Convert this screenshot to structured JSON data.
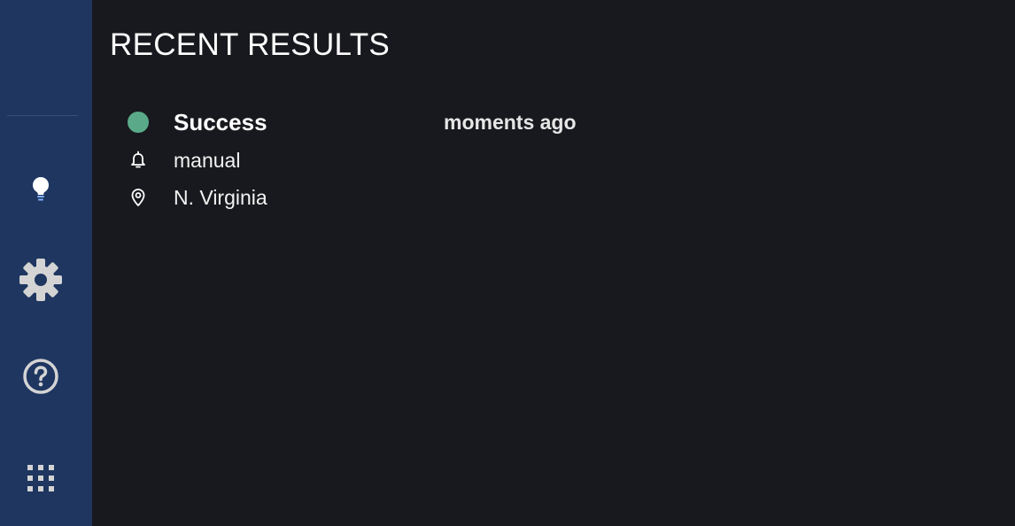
{
  "sidebar": {
    "items": [
      {
        "name": "insights",
        "icon": "lightbulb-icon",
        "color": "#7fb0ff"
      },
      {
        "name": "settings",
        "icon": "gear-icon",
        "color": "#d4d4d4"
      },
      {
        "name": "help",
        "icon": "question-circle-icon",
        "color": "#d4d4d4"
      },
      {
        "name": "apps",
        "icon": "grid-icon",
        "color": "#d4d4d4"
      }
    ]
  },
  "main": {
    "title": "RECENT RESULTS",
    "results": [
      {
        "status": "Success",
        "status_color": "#5aaa8a",
        "time": "moments ago",
        "trigger": "manual",
        "trigger_icon": "bell-icon",
        "location": "N. Virginia",
        "location_icon": "map-pin-icon"
      }
    ]
  },
  "colors": {
    "sidebar_bg": "#1e3660",
    "main_bg": "#18191e"
  }
}
